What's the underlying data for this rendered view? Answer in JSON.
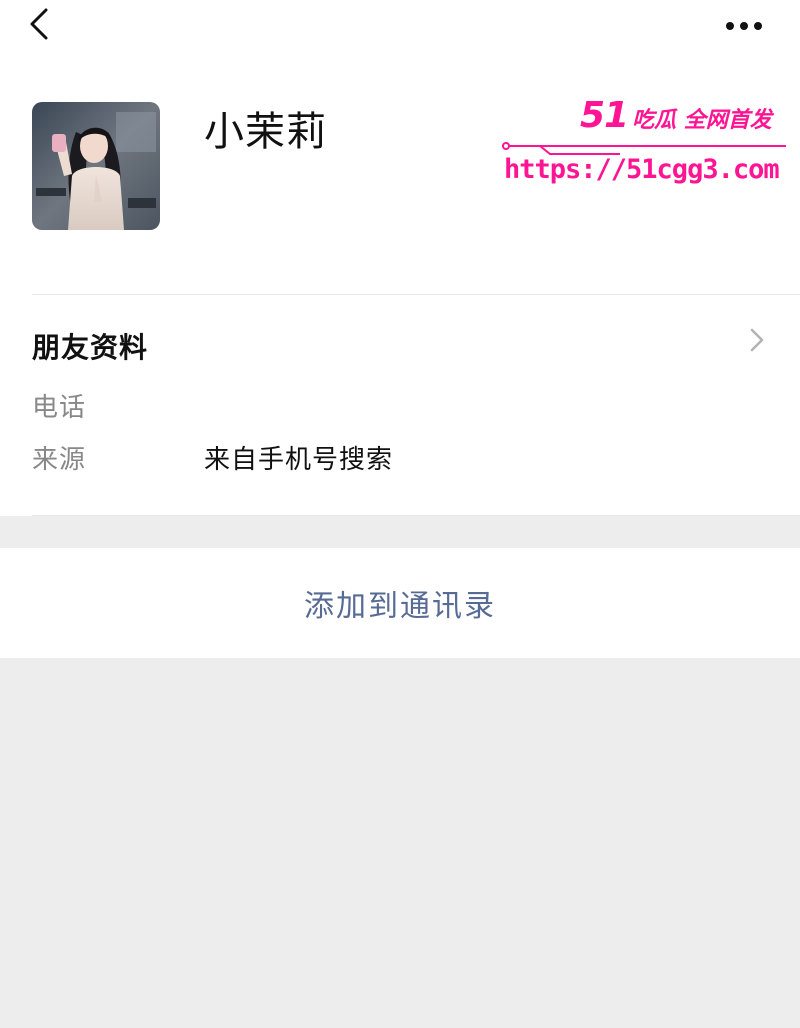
{
  "header": {
    "back_icon": "chevron-left-icon",
    "more_icon": "more-horizontal-icon"
  },
  "profile": {
    "nickname": "小茉莉",
    "avatar": "avatar-photo"
  },
  "watermark": {
    "brand_number": "51",
    "brand_text": "吃瓜 全网首发",
    "url": "https://51cgg3.com",
    "color": "#ff1493"
  },
  "friend_info": {
    "title": "朋友资料",
    "chevron_icon": "chevron-right-icon",
    "rows": [
      {
        "label": "电话",
        "value": ""
      },
      {
        "label": "来源",
        "value": "来自手机号搜索"
      }
    ]
  },
  "actions": {
    "add_contact_label": "添加到通讯录",
    "link_color": "#576b95"
  },
  "colors": {
    "background": "#ededed",
    "card": "#ffffff",
    "label": "#888888",
    "text": "#111111"
  }
}
